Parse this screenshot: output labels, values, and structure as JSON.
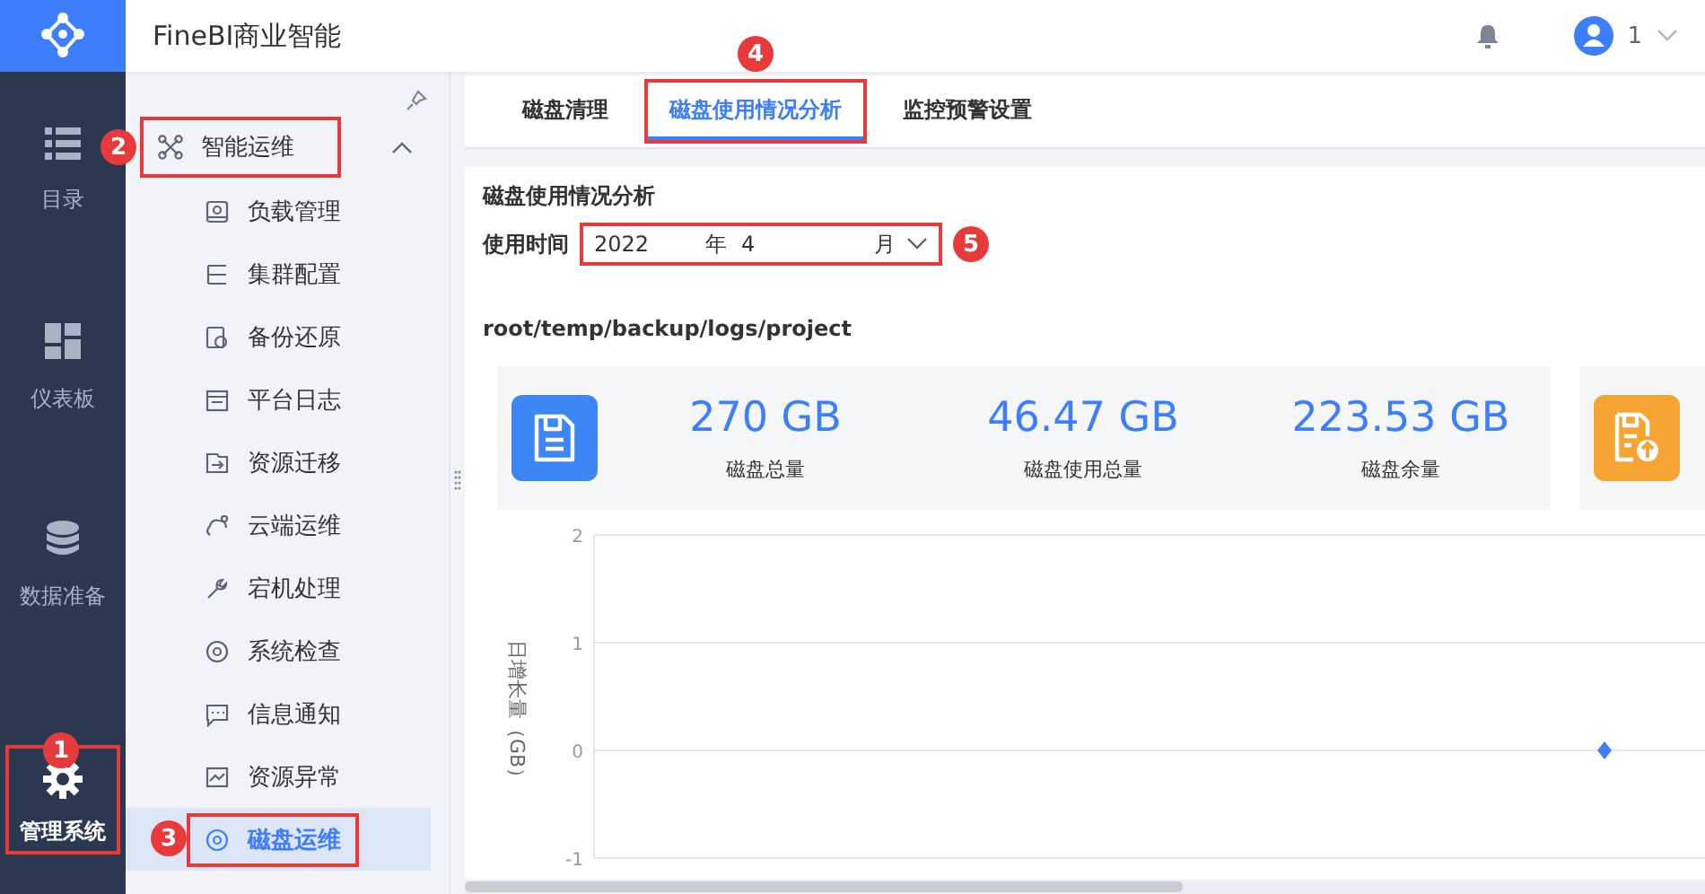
{
  "app_title": "FineBI商业智能",
  "user": {
    "name": "1"
  },
  "rail": [
    {
      "label": "目录",
      "selected": false
    },
    {
      "label": "仪表板",
      "selected": false
    },
    {
      "label": "数据准备",
      "selected": false
    },
    {
      "label": "管理系统",
      "selected": true,
      "callout": "1"
    }
  ],
  "sidebar": {
    "group": {
      "label": "智能运维",
      "expanded": true,
      "callout": "2"
    },
    "items": [
      {
        "label": "负载管理",
        "selected": false
      },
      {
        "label": "集群配置",
        "selected": false
      },
      {
        "label": "备份还原",
        "selected": false
      },
      {
        "label": "平台日志",
        "selected": false
      },
      {
        "label": "资源迁移",
        "selected": false
      },
      {
        "label": "云端运维",
        "selected": false
      },
      {
        "label": "宕机处理",
        "selected": false
      },
      {
        "label": "系统检查",
        "selected": false
      },
      {
        "label": "信息通知",
        "selected": false
      },
      {
        "label": "资源异常",
        "selected": false
      },
      {
        "label": "磁盘运维",
        "selected": true,
        "callout": "3"
      }
    ]
  },
  "tabs": [
    {
      "label": "磁盘清理",
      "selected": false
    },
    {
      "label": "磁盘使用情况分析",
      "selected": true,
      "callout": "4"
    },
    {
      "label": "监控预警设置",
      "selected": false
    }
  ],
  "panel": {
    "title": "磁盘使用情况分析",
    "time_label": "使用时间",
    "year": "2022",
    "year_unit": "年",
    "month": "4",
    "month_unit": "月",
    "time_callout": "5",
    "path": "root/temp/backup/logs/project"
  },
  "stats": [
    {
      "value": "270 GB",
      "label": "磁盘总量"
    },
    {
      "value": "46.47 GB",
      "label": "磁盘使用总量"
    },
    {
      "value": "223.53 GB",
      "label": "磁盘余量"
    }
  ],
  "chart_data": {
    "type": "line",
    "ylabel": "日增长量（GB）",
    "ylim": [
      -1,
      2
    ],
    "yticks": [
      -1,
      0,
      1,
      2
    ],
    "series": [
      {
        "color": "#3d7eff",
        "marker": "diamond",
        "values": [
          0
        ]
      }
    ]
  }
}
